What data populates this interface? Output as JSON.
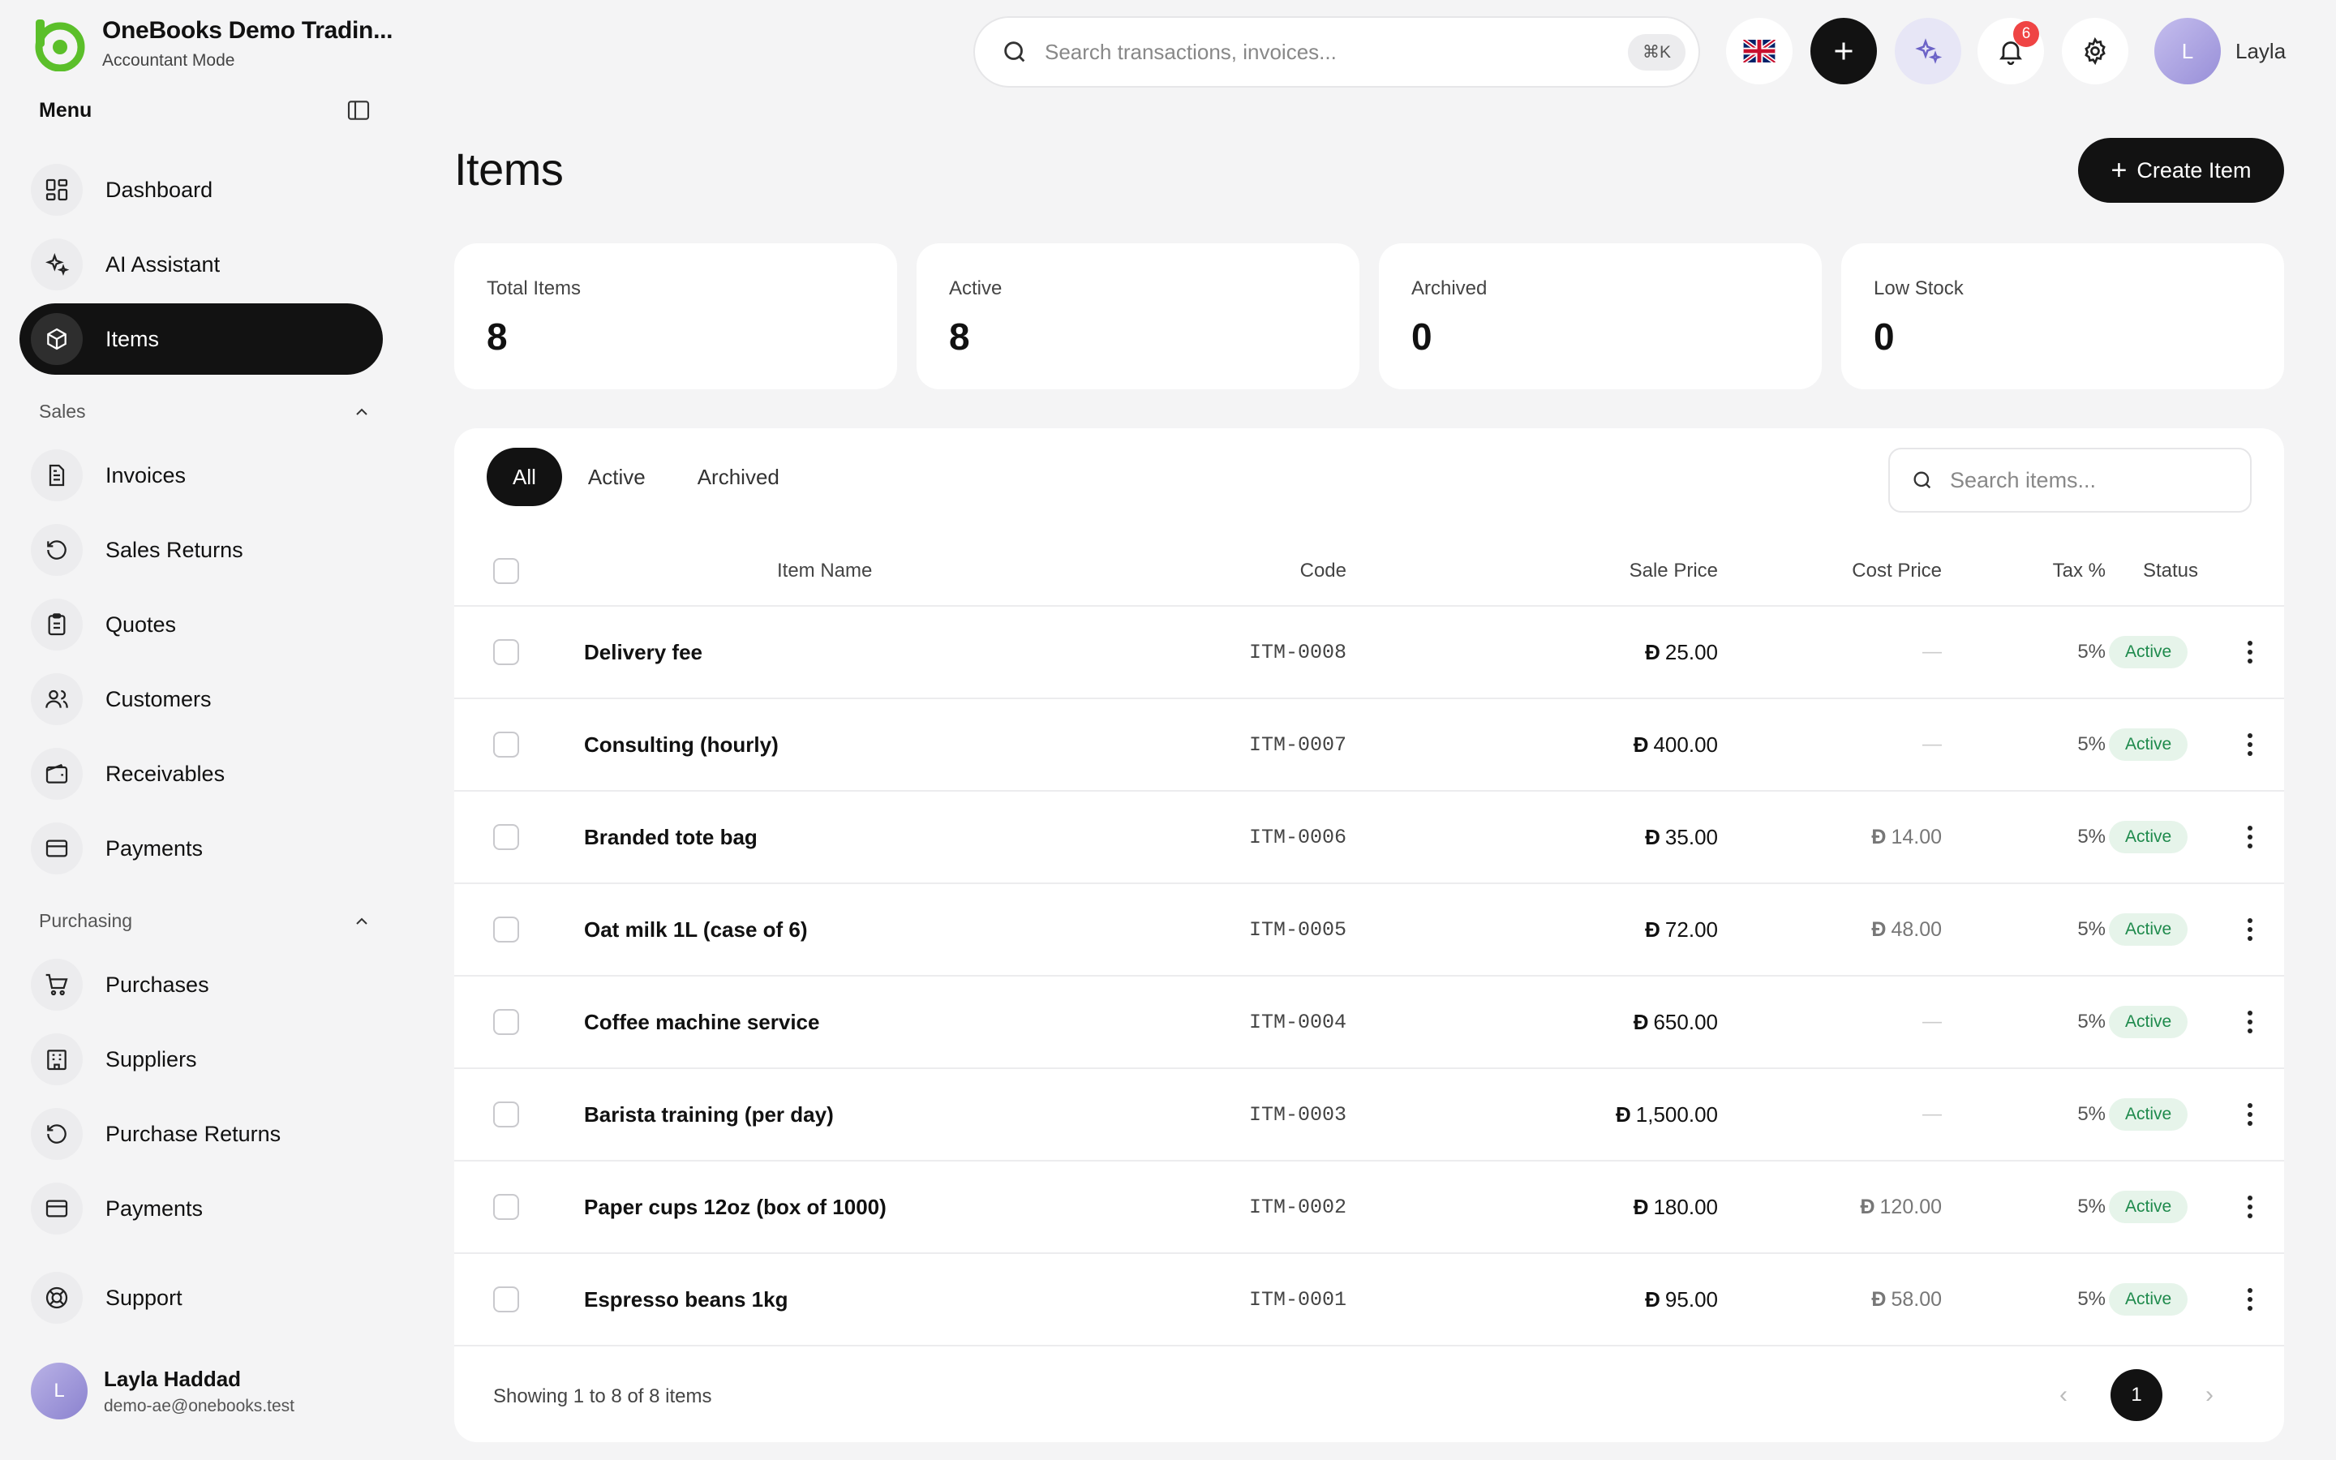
{
  "brand": {
    "name": "OneBooks Demo Tradin...",
    "mode": "Accountant Mode"
  },
  "menu": {
    "title": "Menu"
  },
  "nav": {
    "dashboard": "Dashboard",
    "ai": "AI Assistant",
    "items": "Items",
    "sales_head": "Sales",
    "invoices": "Invoices",
    "sales_returns": "Sales Returns",
    "quotes": "Quotes",
    "customers": "Customers",
    "receivables": "Receivables",
    "payments_sales": "Payments",
    "purchasing_head": "Purchasing",
    "purchases": "Purchases",
    "suppliers": "Suppliers",
    "purchase_returns": "Purchase Returns",
    "payments_purch": "Payments",
    "support": "Support"
  },
  "user": {
    "name": "Layla Haddad",
    "email": "demo-ae@onebooks.test",
    "initial": "L",
    "short": "Layla"
  },
  "topbar": {
    "search_placeholder": "Search transactions, invoices...",
    "shortcut": "⌘K",
    "notif_count": "6"
  },
  "page": {
    "title": "Items",
    "create_label": "Create Item"
  },
  "stats": [
    {
      "label": "Total Items",
      "value": "8"
    },
    {
      "label": "Active",
      "value": "8"
    },
    {
      "label": "Archived",
      "value": "0"
    },
    {
      "label": "Low Stock",
      "value": "0"
    }
  ],
  "tabs": [
    "All",
    "Active",
    "Archived"
  ],
  "items_search_placeholder": "Search items...",
  "columns": {
    "name": "Item Name",
    "code": "Code",
    "sale": "Sale Price",
    "cost": "Cost Price",
    "tax": "Tax %",
    "status": "Status"
  },
  "currency_symbol": "Đ",
  "rows": [
    {
      "name": "Delivery fee",
      "code": "ITM-0008",
      "sale": "25.00",
      "cost": "—",
      "tax": "5%",
      "status": "Active"
    },
    {
      "name": "Consulting (hourly)",
      "code": "ITM-0007",
      "sale": "400.00",
      "cost": "—",
      "tax": "5%",
      "status": "Active"
    },
    {
      "name": "Branded tote bag",
      "code": "ITM-0006",
      "sale": "35.00",
      "cost": "14.00",
      "tax": "5%",
      "status": "Active"
    },
    {
      "name": "Oat milk 1L (case of 6)",
      "code": "ITM-0005",
      "sale": "72.00",
      "cost": "48.00",
      "tax": "5%",
      "status": "Active"
    },
    {
      "name": "Coffee machine service",
      "code": "ITM-0004",
      "sale": "650.00",
      "cost": "—",
      "tax": "5%",
      "status": "Active"
    },
    {
      "name": "Barista training (per day)",
      "code": "ITM-0003",
      "sale": "1,500.00",
      "cost": "—",
      "tax": "5%",
      "status": "Active"
    },
    {
      "name": "Paper cups 12oz (box of 1000)",
      "code": "ITM-0002",
      "sale": "180.00",
      "cost": "120.00",
      "tax": "5%",
      "status": "Active"
    },
    {
      "name": "Espresso beans 1kg",
      "code": "ITM-0001",
      "sale": "95.00",
      "cost": "58.00",
      "tax": "5%",
      "status": "Active"
    }
  ],
  "footer": {
    "showing": "Showing 1 to 8 of 8 items",
    "page": "1"
  },
  "colors": {
    "accent_dark": "#121212",
    "brand_green": "#5bbf2a",
    "status_green": "#1e8a4c",
    "badge_red": "#ef4444"
  }
}
